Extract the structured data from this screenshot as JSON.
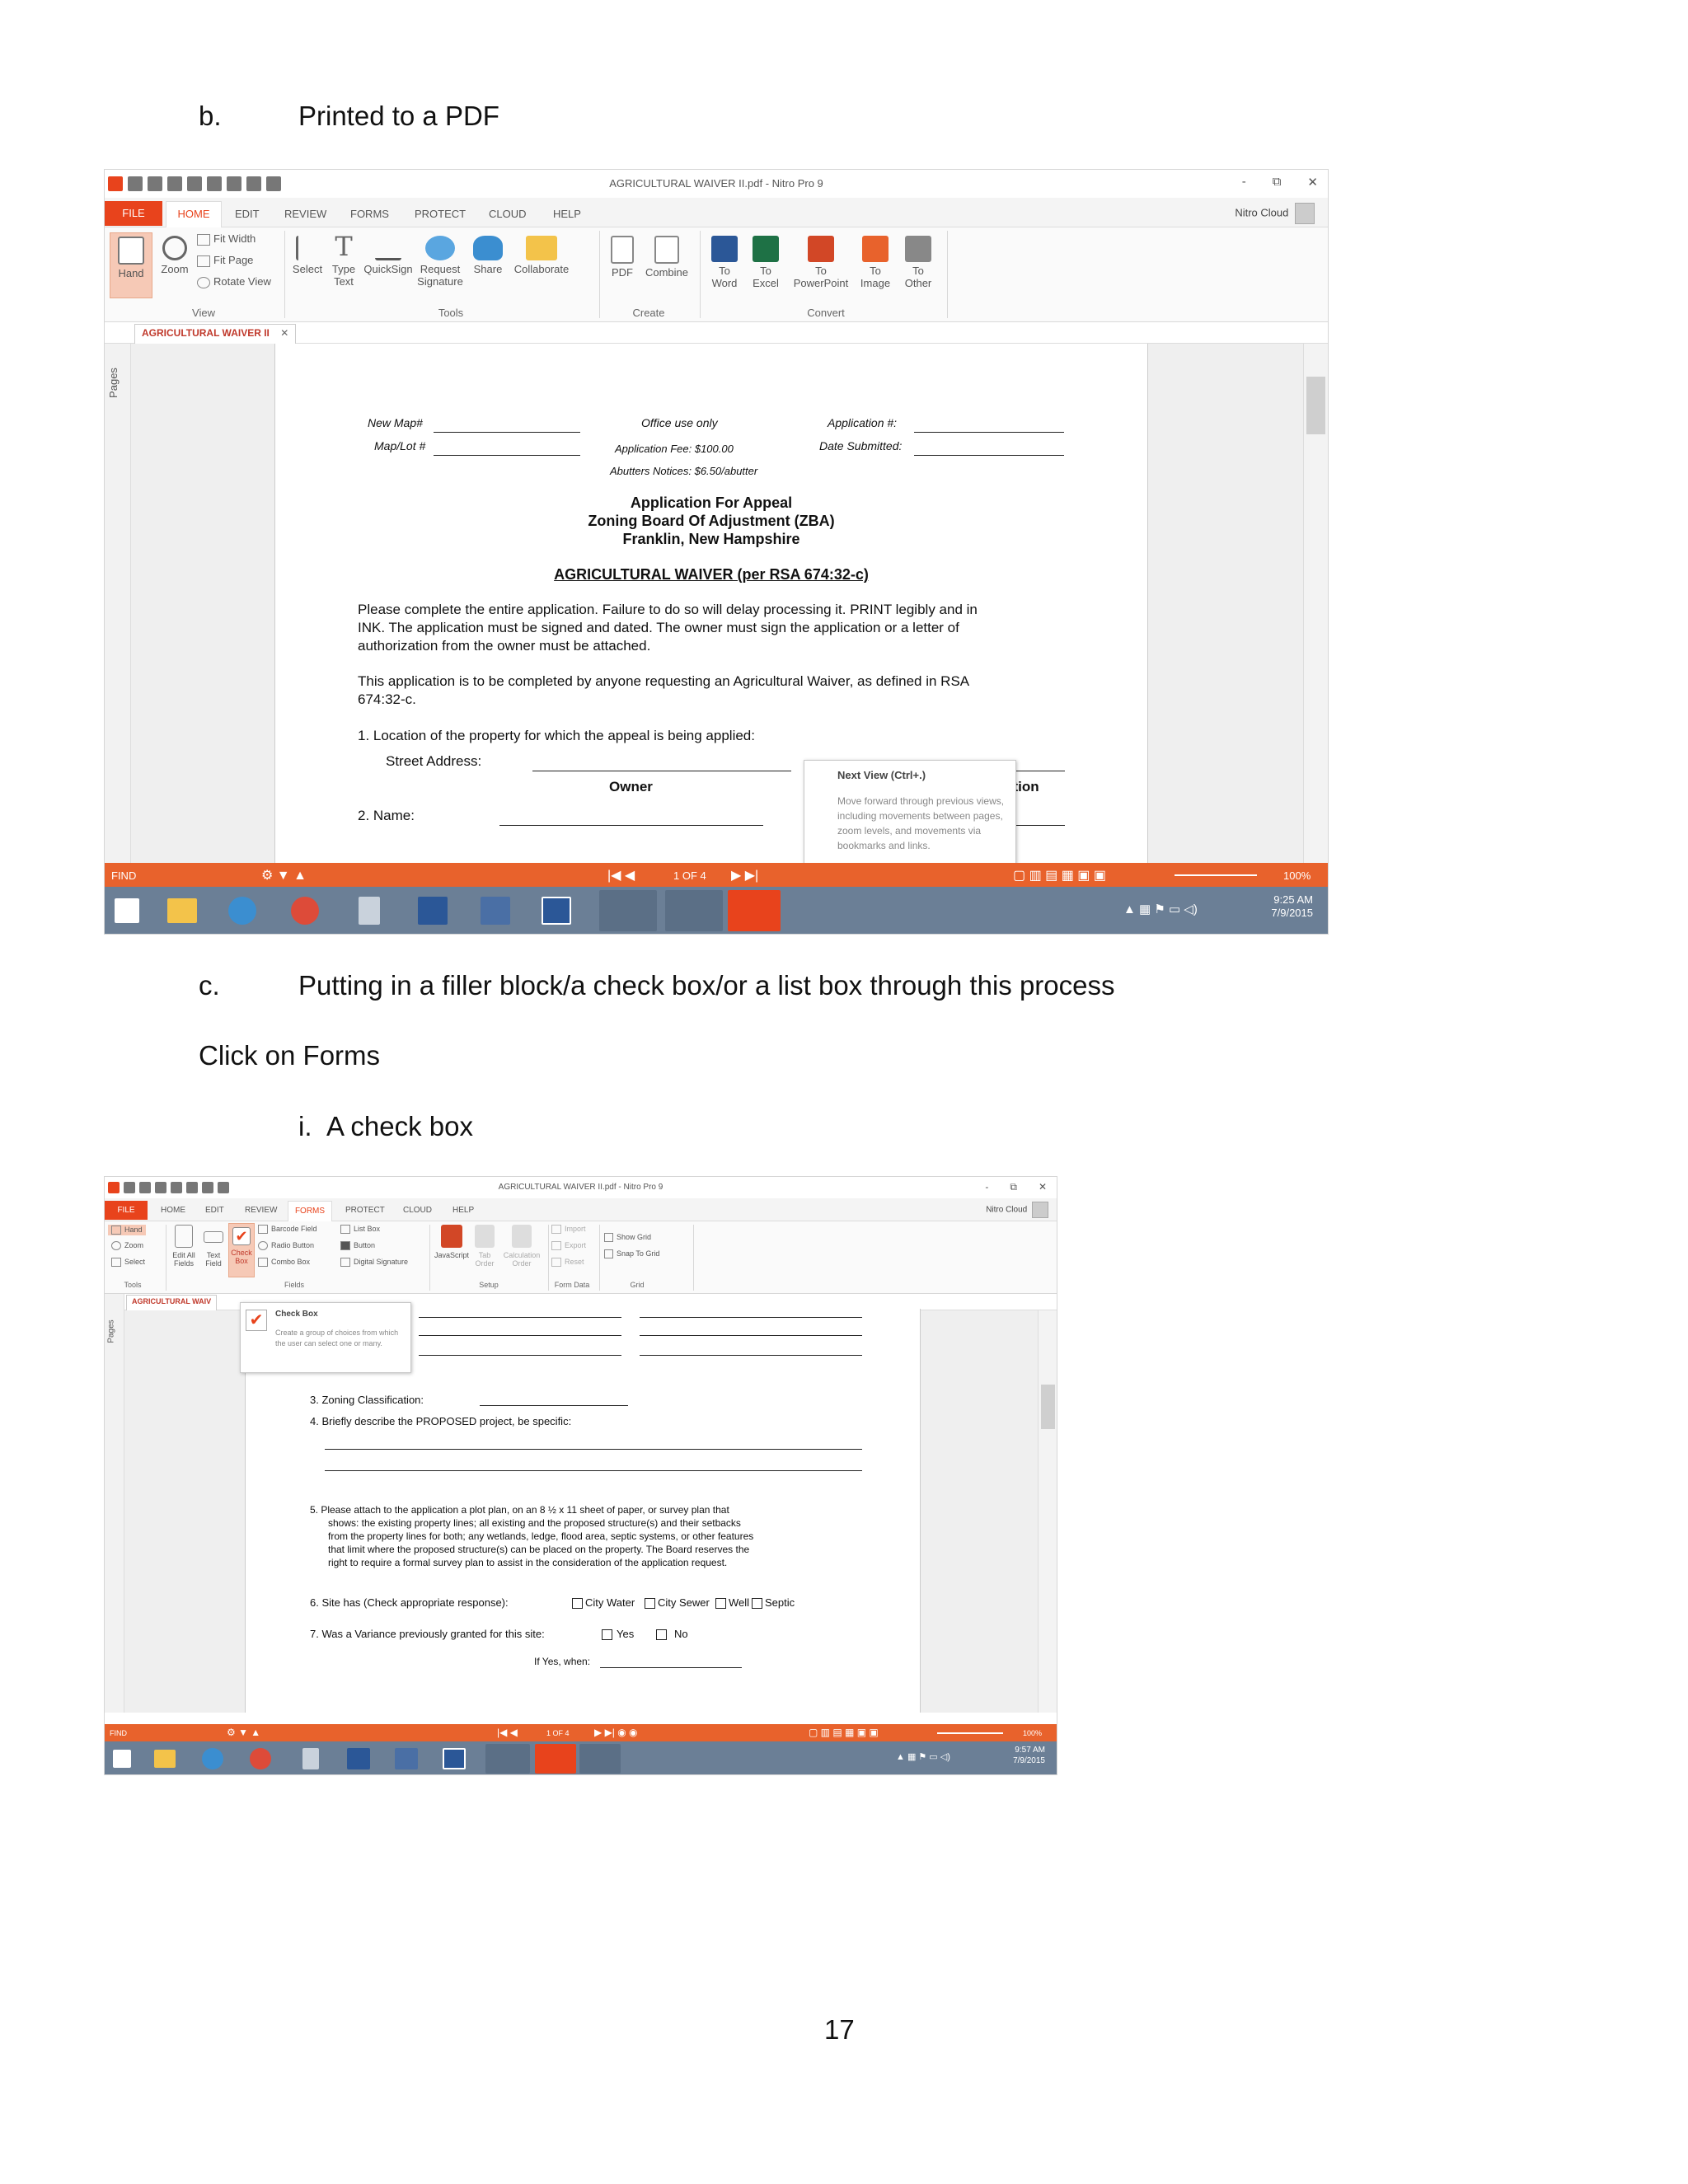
{
  "document": {
    "item_b": {
      "marker": "b.",
      "text": "Printed to a PDF"
    },
    "item_c": {
      "marker": "c.",
      "text": "Putting in a filler block/a check box/or a list box through this process"
    },
    "click_on_forms": "Click on Forms",
    "item_i": {
      "marker": "i.",
      "text": "A check box"
    },
    "page_number": "17"
  },
  "screenshot1": {
    "window_title": "AGRICULTURAL WAIVER II.pdf - Nitro Pro 9",
    "window_controls": [
      "-",
      "⧉",
      "✕"
    ],
    "tabs": [
      "FILE",
      "HOME",
      "EDIT",
      "REVIEW",
      "FORMS",
      "PROTECT",
      "CLOUD",
      "HELP"
    ],
    "active_tab": "HOME",
    "account": "Nitro Cloud",
    "ribbon": {
      "view": {
        "hand": "Hand",
        "zoom": "Zoom",
        "fit_width": "Fit Width",
        "fit_page": "Fit Page",
        "rotate_view": "Rotate View",
        "label": "View"
      },
      "tools": {
        "select": "Select",
        "type_text": "Type Text",
        "quicksign": "QuickSign",
        "request_signature": "Request Signature",
        "share": "Share",
        "collaborate": "Collaborate",
        "label": "Tools"
      },
      "create": {
        "pdf": "PDF",
        "combine": "Combine",
        "label": "Create"
      },
      "convert": {
        "to_word": "To Word",
        "to_excel": "To Excel",
        "to_powerpoint": "To PowerPoint",
        "to_image": "To Image",
        "to_other": "To Other",
        "label": "Convert"
      }
    },
    "doc_tab": "AGRICULTURAL WAIVER II",
    "sidebar_label": "Pages",
    "page": {
      "new_map": "New Map#",
      "map_lot": "Map/Lot #",
      "office_use": "Office use only",
      "application_fee": "Application Fee:  $100.00",
      "abutters": "Abutters Notices: $6.50/abutter",
      "application_no": "Application #:",
      "date_submitted": "Date Submitted:",
      "heading1": "Application For Appeal",
      "heading2": "Zoning Board Of Adjustment (ZBA)",
      "heading3": "Franklin, New Hampshire",
      "waiver_title": "AGRICULTURAL WAIVER (per RSA 674:32-c)",
      "para1_l1": "Please complete the entire application.  Failure to do so will delay processing it.  PRINT legibly and in",
      "para1_l2": "INK.  The application must be signed and dated.  The owner must sign the application or a letter of",
      "para1_l3": "authorization from the owner must be attached.",
      "para2_l1": "This application is to be completed by anyone requesting an Agricultural Waiver, as defined in RSA",
      "para2_l2": "674:32-c.",
      "item1": "1.   Location of the property for which the appeal is being applied:",
      "street_address": "Street Address:",
      "owner": "Owner",
      "ation": "ation",
      "item2": "2.   Name:"
    },
    "tooltip": {
      "title": "Next View (Ctrl+.)",
      "body": "Move forward through previous views, including movements between pages, zoom levels, and movements via bookmarks and links."
    },
    "status": {
      "find": "FIND",
      "page": "1 OF 4",
      "zoom": "100%"
    },
    "clock": {
      "time": "9:25 AM",
      "date": "7/9/2015"
    }
  },
  "screenshot2": {
    "window_title": "AGRICULTURAL WAIVER II.pdf - Nitro Pro 9",
    "window_controls": [
      "-",
      "⧉",
      "✕"
    ],
    "tabs": [
      "FILE",
      "HOME",
      "EDIT",
      "REVIEW",
      "FORMS",
      "PROTECT",
      "CLOUD",
      "HELP"
    ],
    "active_tab": "FORMS",
    "account": "Nitro Cloud",
    "ribbon": {
      "tools": {
        "hand": "Hand",
        "zoom": "Zoom",
        "select": "Select",
        "label": "Tools"
      },
      "fields": {
        "edit_all": "Edit All Fields",
        "text_field": "Text Field",
        "check_box": "Check Box",
        "barcode": "Barcode Field",
        "radio": "Radio Button",
        "combo": "Combo Box",
        "list_box": "List Box",
        "button": "Button",
        "digital_sig": "Digital Signature",
        "label": "Fields"
      },
      "setup": {
        "javascript": "JavaScript",
        "tab_order": "Tab Order",
        "calc_order": "Calculation Order",
        "label": "Setup"
      },
      "form_data": {
        "import": "Import",
        "export": "Export",
        "reset": "Reset",
        "label": "Form Data"
      },
      "grid": {
        "show_grid": "Show Grid",
        "snap": "Snap To Grid",
        "label": "Grid"
      }
    },
    "doc_tab": "AGRICULTURAL WAIV",
    "sidebar_label": "Pages",
    "tooltip": {
      "title": "Check Box",
      "body": "Create a group of choices from which the user can select one or many."
    },
    "page": {
      "item3": "3.   Zoning Classification:",
      "item4": "4.   Briefly describe the PROPOSED project, be specific:",
      "item5_l1": "5.   Please attach to the application a plot plan, on an 8 ½ x 11 sheet of paper, or survey plan that",
      "item5_l2": "shows: the existing property lines; all existing and the proposed structure(s) and their setbacks",
      "item5_l3": "from the property lines for both; any wetlands, ledge, flood area, septic systems, or other features",
      "item5_l4": "that limit where the proposed structure(s) can be placed on the property.  The Board reserves the",
      "item5_l5": "right to require a formal survey plan to assist in the consideration of the application request.",
      "item6": "6.   Site has (Check appropriate response):",
      "city_water": "City Water",
      "city_sewer": "City Sewer",
      "well": "Well",
      "septic": "Septic",
      "item7": "7.   Was a Variance previously granted for this site:",
      "yes": "Yes",
      "no": "No",
      "if_yes": "If Yes, when:"
    },
    "status": {
      "find": "FIND",
      "page": "1 OF 4",
      "zoom": "100%"
    },
    "clock": {
      "time": "9:57 AM",
      "date": "7/9/2015"
    }
  },
  "colors": {
    "nitro_orange": "#e8622c",
    "file_tab": "#e8431c",
    "taskbar": "#6b7f96"
  }
}
